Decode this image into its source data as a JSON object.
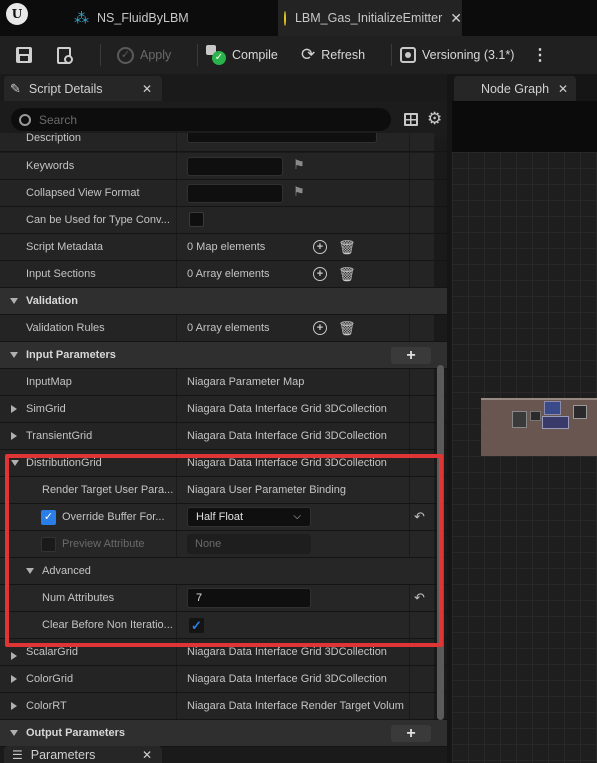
{
  "tabs": [
    {
      "label": "NS_FluidByLBM",
      "active": false
    },
    {
      "label": "LBM_Gas_InitializeEmitter",
      "active": true
    }
  ],
  "toolbar": {
    "apply_label": "Apply",
    "compile_label": "Compile",
    "refresh_label": "Refresh",
    "versioning_label": "Versioning (3.1*)"
  },
  "panels": {
    "script_details_title": "Script Details",
    "node_graph_title": "Node Graph",
    "parameters_title": "Parameters"
  },
  "search": {
    "placeholder": "Search"
  },
  "rows": {
    "description": {
      "label": "Description"
    },
    "keywords": {
      "label": "Keywords"
    },
    "collapsed_view_format": {
      "label": "Collapsed View Format"
    },
    "type_conversion": {
      "label": "Can be Used for Type Conv..."
    },
    "script_metadata": {
      "label": "Script Metadata",
      "value": "0 Map elements"
    },
    "input_sections": {
      "label": "Input Sections",
      "value": "0 Array elements"
    },
    "validation": {
      "label": "Validation"
    },
    "validation_rules": {
      "label": "Validation Rules",
      "value": "0 Array elements"
    },
    "input_parameters": {
      "label": "Input Parameters"
    },
    "input_map": {
      "label": "InputMap",
      "value": "Niagara Parameter Map"
    },
    "sim_grid": {
      "label": "SimGrid",
      "value": "Niagara Data Interface Grid 3DCollection"
    },
    "transient_grid": {
      "label": "TransientGrid",
      "value": "Niagara Data Interface Grid 3DCollection"
    },
    "distribution_grid": {
      "label": "DistributionGrid",
      "value": "Niagara Data Interface Grid 3DCollection"
    },
    "render_target": {
      "label": "Render Target User Para...",
      "value": "Niagara User Parameter Binding"
    },
    "override_buffer": {
      "label": "Override Buffer For...",
      "value": "Half Float",
      "checked": true
    },
    "preview_attribute": {
      "label": "Preview Attribute",
      "value": "None",
      "checked": false
    },
    "advanced": {
      "label": "Advanced"
    },
    "num_attributes": {
      "label": "Num Attributes",
      "value": "7"
    },
    "clear_before": {
      "label": "Clear Before Non Iteratio...",
      "checked": true
    },
    "scalar_grid": {
      "label": "ScalarGrid",
      "value": "Niagara Data Interface Grid 3DCollection"
    },
    "color_grid": {
      "label": "ColorGrid",
      "value": "Niagara Data Interface Grid 3DCollection"
    },
    "color_rt": {
      "label": "ColorRT",
      "value": "Niagara Data Interface Render Target Volum"
    },
    "output_parameters": {
      "label": "Output Parameters"
    }
  },
  "colors": {
    "highlight": "#e03535",
    "accent": "#2a7ee8",
    "panel": "#242424"
  }
}
